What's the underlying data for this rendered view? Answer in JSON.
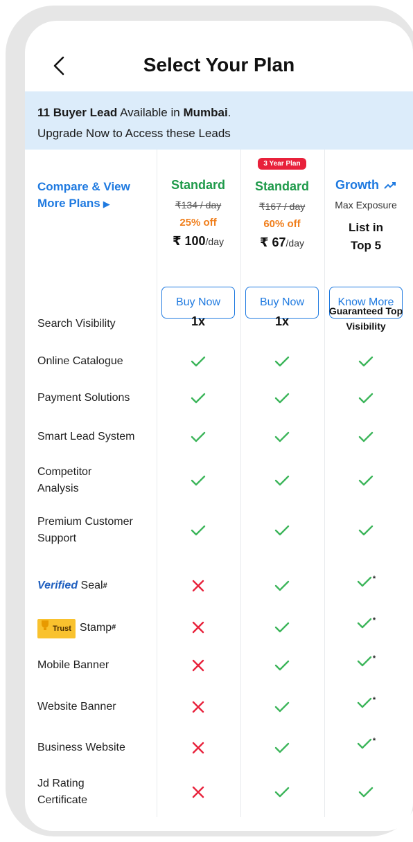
{
  "header": {
    "title": "Select Your Plan"
  },
  "banner": {
    "count_text": "11 Buyer Lead",
    "available_text": " Available in ",
    "city": "Mumbai",
    "period": ".",
    "line2": "Upgrade Now to Access these Leads"
  },
  "compare": {
    "line1": "Compare & View",
    "line2": "More Plans"
  },
  "plans": [
    {
      "badge": "",
      "name": "Standard",
      "old_price": "₹134 / day",
      "discount": "25% off",
      "price": "₹ 100",
      "unit": "/day",
      "button": "Buy Now"
    },
    {
      "badge": "3 Year Plan",
      "name": "Standard",
      "old_price": "₹167 / day",
      "discount": "60% off",
      "price": "₹ 67",
      "unit": "/day",
      "button": "Buy Now"
    },
    {
      "name": "Growth",
      "subtitle": "Max Exposure",
      "list_line1": "List in",
      "list_line2": "Top 5",
      "button": "Know More"
    }
  ],
  "features": [
    {
      "label": "Search Visibility",
      "values": [
        "1x",
        "1x",
        "Guaranteed Top Visibility"
      ]
    },
    {
      "label": "Online Catalogue",
      "values": [
        "check",
        "check",
        "check"
      ]
    },
    {
      "label": "Payment Solutions",
      "values": [
        "check",
        "check",
        "check"
      ]
    },
    {
      "label": "Smart Lead System",
      "values": [
        "check",
        "check",
        "check"
      ]
    },
    {
      "label": "Competitor Analysis",
      "values": [
        "check",
        "check",
        "check"
      ]
    },
    {
      "label": "Premium Customer Support",
      "values": [
        "check",
        "check",
        "check"
      ]
    },
    {
      "label": "Seal",
      "prefix": "Verified",
      "sup": "#",
      "values": [
        "cross",
        "check",
        "check*"
      ]
    },
    {
      "label": "Stamp",
      "prefix": "Trust",
      "sup": "#",
      "values": [
        "cross",
        "check",
        "check*"
      ]
    },
    {
      "label": "Mobile Banner",
      "values": [
        "cross",
        "check",
        "check*"
      ]
    },
    {
      "label": "Website Banner",
      "values": [
        "cross",
        "check",
        "check*"
      ]
    },
    {
      "label": "Business Website",
      "values": [
        "cross",
        "check",
        "check*"
      ]
    },
    {
      "label": "Jd Rating Certificate",
      "values": [
        "cross",
        "check",
        "check"
      ]
    }
  ],
  "colors": {
    "accent": "#1f7ae0",
    "check": "#3cb55a",
    "cross": "#e8213b",
    "offer": "#f07e1b",
    "banner": "#dcecfa"
  }
}
